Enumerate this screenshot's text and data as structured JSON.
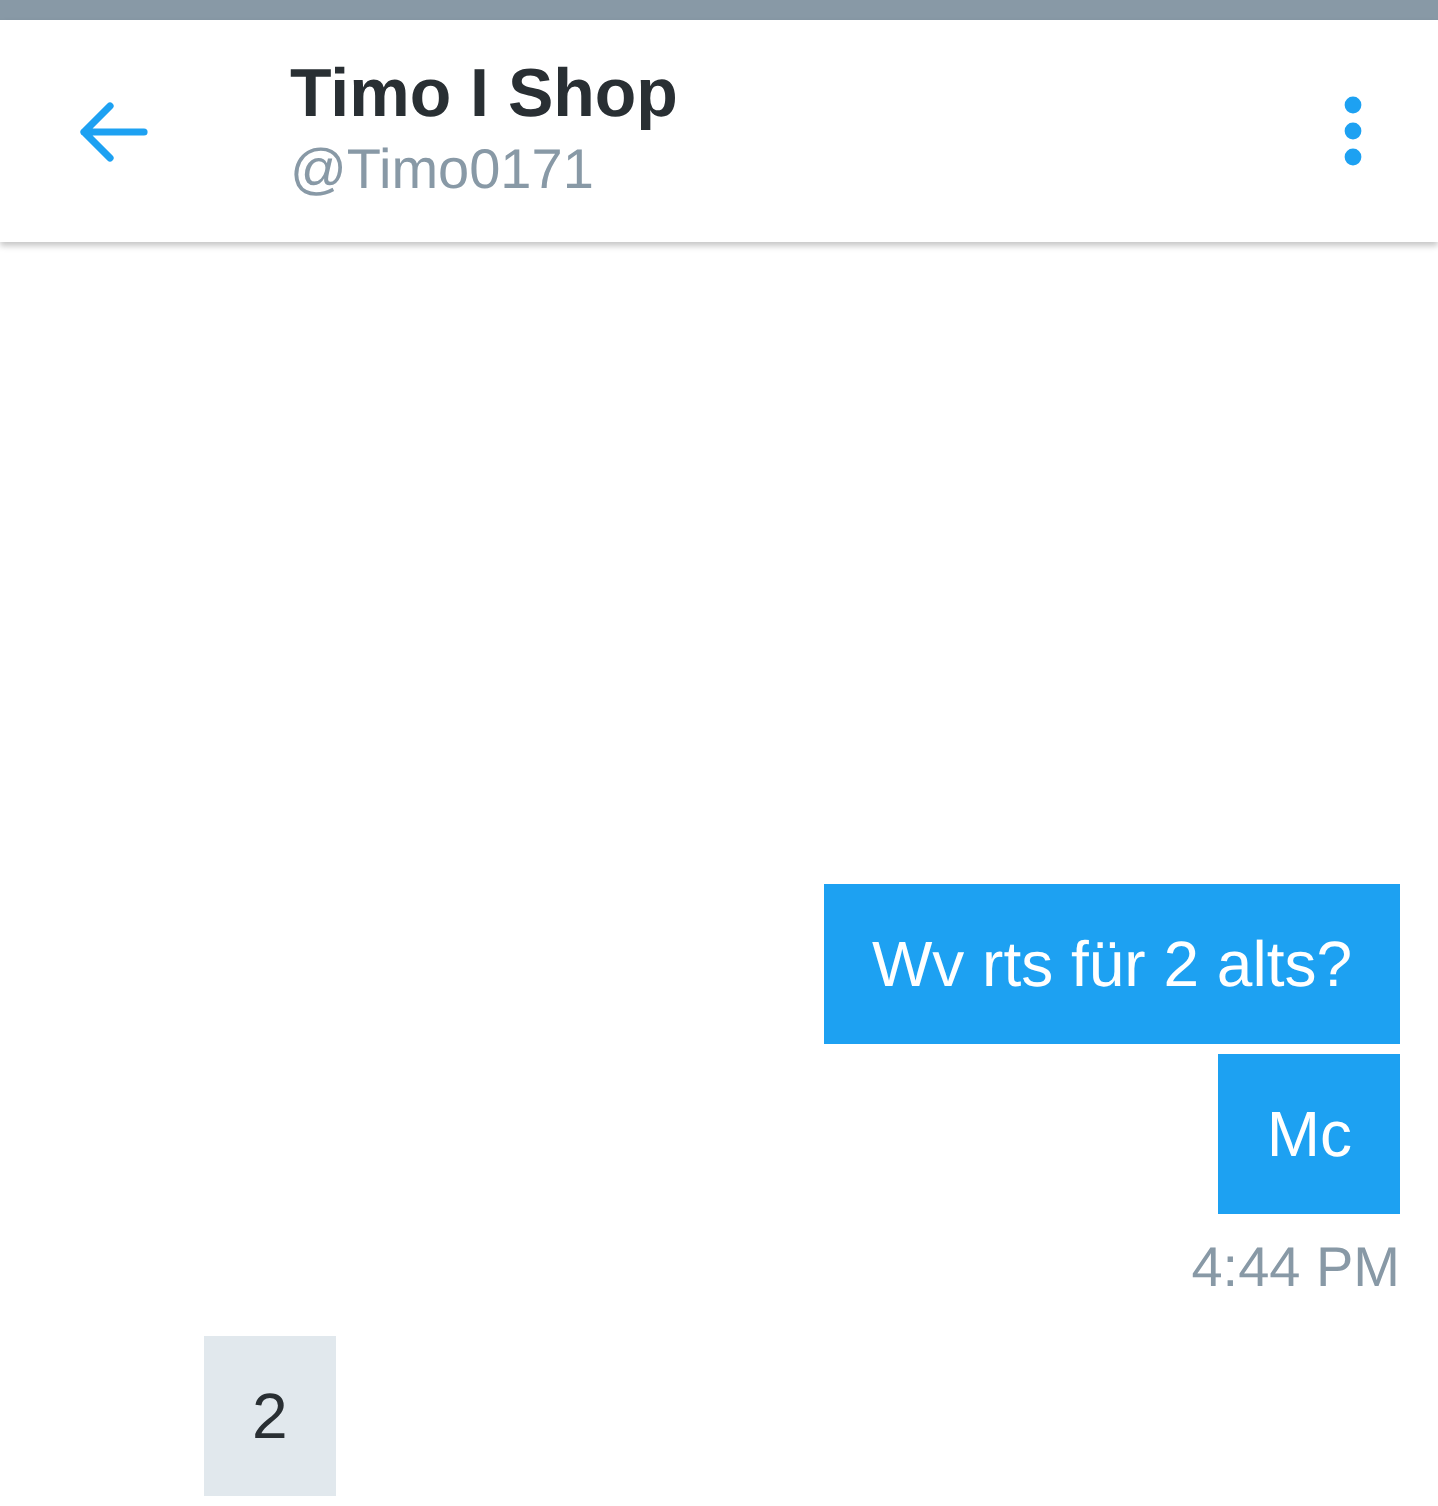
{
  "header": {
    "title": "Timo I Shop",
    "handle": "@Timo0171"
  },
  "messages": [
    {
      "kind": "sent",
      "text": "Wv rts für 2 alts?"
    },
    {
      "kind": "sent",
      "text": "Mc"
    },
    {
      "kind": "timestamp",
      "text": "4:44 PM"
    },
    {
      "kind": "received",
      "text": "2"
    }
  ]
}
